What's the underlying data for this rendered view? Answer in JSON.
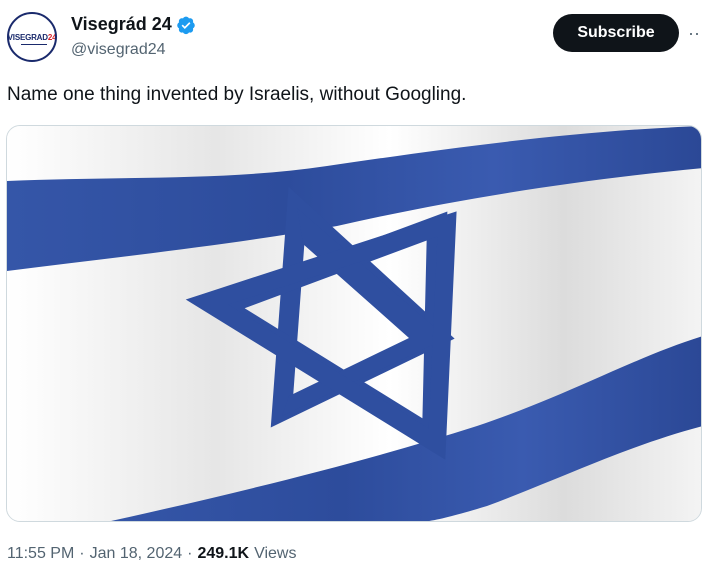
{
  "author": {
    "display_name": "Visegrád 24",
    "handle": "@visegrad24",
    "avatar_text_main": "VISEGRAD",
    "avatar_text_num": "24",
    "verified": true
  },
  "actions": {
    "subscribe_label": "Subscribe",
    "more_label": "··"
  },
  "tweet": {
    "text": "Name one thing invented by Israelis, without Googling.",
    "media_icon": "israeli-flag-image"
  },
  "meta": {
    "time": "11:55 PM",
    "separator": "·",
    "date": "Jan 18, 2024",
    "separator2": "·",
    "views_count": "249.1K",
    "views_label": "Views"
  },
  "colors": {
    "flag_blue": "#2f4fa0",
    "verified_blue": "#1d9bf0",
    "button_bg": "#0f1419"
  }
}
